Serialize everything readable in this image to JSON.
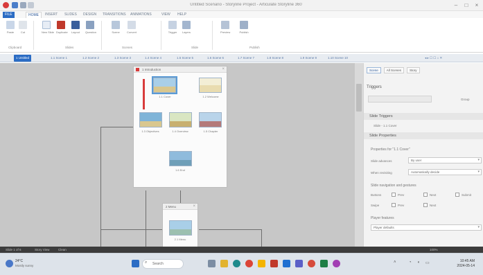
{
  "window": {
    "title": "Untitled Scenario - Storyline Project - Articulate Storyline 360",
    "controls": [
      "minimize-icon",
      "maximize-icon",
      "close-icon"
    ]
  },
  "ribbon": {
    "tabs": [
      "FILE",
      "HOME",
      "INSERT",
      "SLIDES",
      "DESIGN",
      "TRANSITIONS",
      "ANIMATIONS",
      "VIEW",
      "HELP"
    ],
    "active_tab": "HOME",
    "groups": [
      {
        "label": "Clipboard",
        "buttons": [
          "Paste",
          "Cut"
        ]
      },
      {
        "label": "Slides",
        "buttons": [
          "New Slide",
          "Duplicate",
          "Layout",
          "Question"
        ]
      },
      {
        "label": "Scenes",
        "buttons": [
          "Scene",
          "Convert"
        ]
      },
      {
        "label": "Slide",
        "buttons": [
          "Trigger",
          "Layers"
        ]
      },
      {
        "label": "Publish",
        "buttons": [
          "Preview",
          "Publish"
        ]
      }
    ]
  },
  "scene_tabs": [
    "1 Untitled",
    "1.1 Scene 1",
    "1.2 Scene 2",
    "1.3 Scene 3",
    "1.4 Scene 4",
    "1.5 Scene 5",
    "1.6 Scene 6",
    "1.7 Scene 7",
    "1.8 Scene 8",
    "1.9 Scene 9",
    "1.10 Scene 10"
  ],
  "story_view": {
    "main_card": {
      "title": "1 Introduction",
      "slides": [
        "1.1 Cover",
        "1.2 Welcome",
        "1.3 Objectives",
        "1.4 Overview",
        "1.5 Chapter",
        "1.6 End"
      ]
    },
    "small_card": {
      "title": "2 Menu",
      "slides": [
        "2.1 Menu"
      ]
    }
  },
  "right_panel": {
    "tabs": [
      "Scene",
      "All Scenes",
      "Story"
    ],
    "triggers_title": "Triggers",
    "triggers_button": "Group",
    "slide_triggers_title": "Slide Triggers",
    "slide_trigger_item": "Slide - 1.1 Cover",
    "properties_title": "Slide Properties",
    "properties_for": "Properties for \"1.1 Cover\"",
    "slide_advances_label": "Slide advances",
    "slide_advances_value": "By user",
    "revisiting_label": "When revisiting",
    "revisiting_value": "Automatically decide",
    "nav_title": "Slide navigation and gestures",
    "buttons_label": "Buttons",
    "prev_label": "Prev",
    "next_label": "Next",
    "submit_label": "Submit",
    "swipe_label": "Swipe",
    "player_features_title": "Player features",
    "player_features_value": "Player defaults"
  },
  "status_bar": {
    "slide_info": "Slide 1 of 6",
    "view_label": "Story View",
    "theme_label": "Clean",
    "zoom_label": "100%"
  },
  "taskbar": {
    "weather_temp": "24°C",
    "weather_text": "Mostly sunny",
    "search_placeholder": "Search",
    "time": "10:45 AM",
    "date": "2024-05-14",
    "colors": {
      "accent": "#2b6cc4",
      "flag": "#d83b3b"
    }
  }
}
